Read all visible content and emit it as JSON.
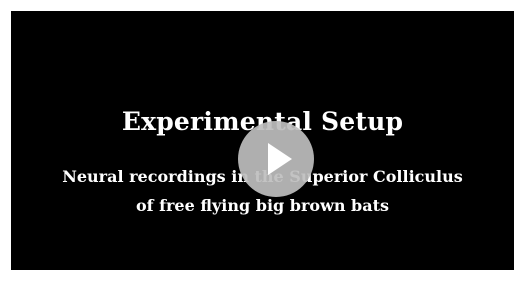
{
  "video": {
    "title": "Experimental Setup",
    "subtitle_line1": "Neural recordings in the Superior Colliculus",
    "subtitle_line2": "of free flying big brown bats",
    "play_icon": "play-icon"
  },
  "colors": {
    "background": "#ffffff",
    "video_background": "#000000",
    "text": "#ffffff",
    "play_button": "#bebebe"
  }
}
